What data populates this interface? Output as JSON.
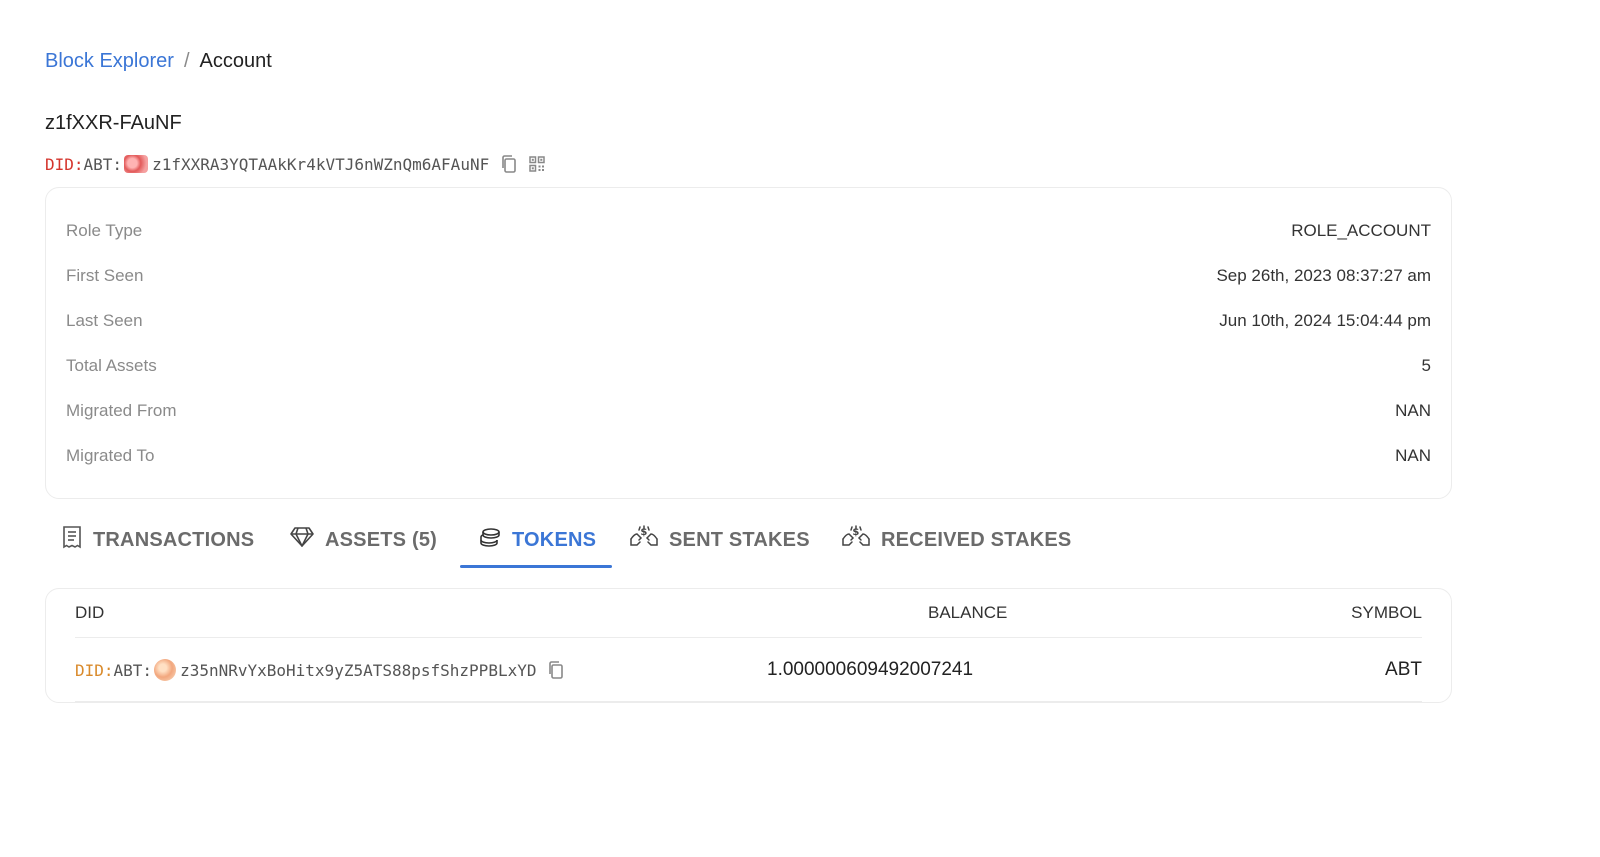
{
  "breadcrumb": {
    "root": "Block Explorer",
    "separator": "/",
    "current": "Account"
  },
  "account": {
    "name": "z1fXXR-FAuNF",
    "did_prefix": "DID:",
    "did_type": "ABT:",
    "address": "z1fXXRA3YQTAAkKr4kVTJ6nWZnQm6AFAuNF"
  },
  "info": [
    {
      "label": "Role Type",
      "value": "ROLE_ACCOUNT"
    },
    {
      "label": "First Seen",
      "value": "Sep 26th, 2023 08:37:27 am"
    },
    {
      "label": "Last Seen",
      "value": "Jun 10th, 2024 15:04:44 pm"
    },
    {
      "label": "Total Assets",
      "value": "5"
    },
    {
      "label": "Migrated From",
      "value": "NAN"
    },
    {
      "label": "Migrated To",
      "value": "NAN"
    }
  ],
  "tabs": [
    {
      "label": "TRANSACTIONS",
      "icon": "receipt-icon"
    },
    {
      "label": "ASSETS (5)",
      "icon": "diamond-icon"
    },
    {
      "label": "TOKENS",
      "icon": "coins-icon",
      "active": true
    },
    {
      "label": "SENT STAKES",
      "icon": "hand-coin-icon"
    },
    {
      "label": "RECEIVED STAKES",
      "icon": "hand-coin-icon"
    }
  ],
  "tokens_table": {
    "headers": {
      "did": "DID",
      "balance": "BALANCE",
      "symbol": "SYMBOL"
    },
    "rows": [
      {
        "did_prefix": "DID:",
        "did_type": "ABT:",
        "address": "z35nNRvYxBoHitx9yZ5ATS88psfShzPPBLxYD",
        "balance": "1.000000609492007241",
        "symbol": "ABT"
      }
    ]
  },
  "colors": {
    "accent": "#3b76d6",
    "did_red": "#d4342c",
    "did_orange": "#d98a2b"
  }
}
